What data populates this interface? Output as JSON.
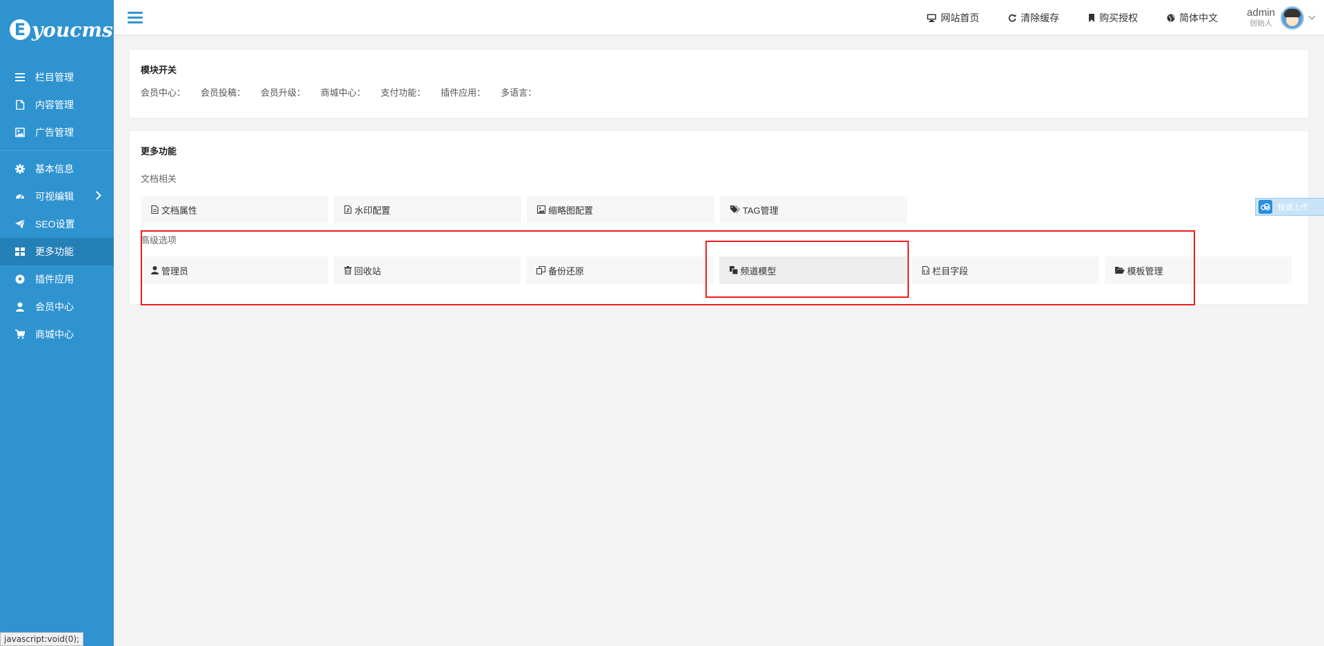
{
  "brand": {
    "mark": "E",
    "name": "youcms"
  },
  "sidebar": {
    "groups": [
      [
        {
          "label": "栏目管理",
          "icon": "list-icon"
        },
        {
          "label": "内容管理",
          "icon": "file-icon"
        },
        {
          "label": "广告管理",
          "icon": "image-icon"
        }
      ],
      [
        {
          "label": "基本信息",
          "icon": "gear-icon"
        },
        {
          "label": "可视编辑",
          "icon": "dashboard-icon"
        },
        {
          "label": "SEO设置",
          "icon": "paper-plane-icon"
        },
        {
          "label": "更多功能",
          "icon": "grid-icon",
          "active": true
        },
        {
          "label": "插件应用",
          "icon": "soccer-ball-icon"
        },
        {
          "label": "会员中心",
          "icon": "user-icon"
        },
        {
          "label": "商城中心",
          "icon": "cart-icon"
        }
      ]
    ]
  },
  "status_bar": "javascript:void(0);",
  "header": {
    "links": [
      {
        "label": "网站首页",
        "icon": "monitor-icon"
      },
      {
        "label": "清除缓存",
        "icon": "refresh-icon"
      },
      {
        "label": "购买授权",
        "icon": "bookmark-icon"
      },
      {
        "label": "简体中文",
        "icon": "globe-icon"
      }
    ],
    "user": {
      "name": "admin",
      "role": "创始人"
    }
  },
  "modules": {
    "title": "模块开关",
    "items": [
      "会员中心：",
      "会员投稿：",
      "会员升级：",
      "商城中心：",
      "支付功能：",
      "插件应用：",
      "多语言："
    ]
  },
  "more": {
    "title": "更多功能",
    "doc_label": "文档相关",
    "doc_buttons": [
      {
        "label": "文档属性",
        "icon": "file-text-icon"
      },
      {
        "label": "水印配置",
        "icon": "file-watermark-icon"
      },
      {
        "label": "缩略图配置",
        "icon": "image-icon"
      },
      {
        "label": "TAG管理",
        "icon": "tags-icon"
      }
    ],
    "adv_label": "高级选项",
    "adv_buttons": [
      {
        "label": "管理员",
        "icon": "user-icon"
      },
      {
        "label": "回收站",
        "icon": "trash-icon"
      },
      {
        "label": "备份还原",
        "icon": "copy-icon"
      },
      {
        "label": "频道模型",
        "icon": "clone-icon"
      },
      {
        "label": "栏目字段",
        "icon": "file-code-icon"
      },
      {
        "label": "模板管理",
        "icon": "folder-open-icon"
      }
    ]
  },
  "float_widget": {
    "label": "极速上传",
    "icon": "cloud-icon"
  },
  "colors": {
    "sidebar": "#2f93d0",
    "sidebar_active": "#2680b8",
    "highlight_border": "#ee1b1b"
  }
}
